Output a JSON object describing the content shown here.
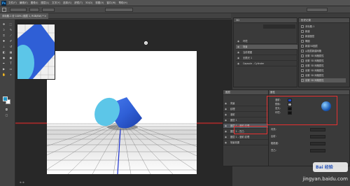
{
  "app": {
    "logo": "Ps"
  },
  "menu": [
    "文件(F)",
    "编辑(E)",
    "图像(I)",
    "图层(L)",
    "文字(Y)",
    "选择(S)",
    "滤镜(T)",
    "3D(D)",
    "视图(V)",
    "窗口(W)",
    "帮助(H)"
  ],
  "document_tab": {
    "label": "未标题-1 @ 100% (图层 1, RGB/8#) * ×"
  },
  "status": {
    "text": "⊕ ⊕"
  },
  "panels": {
    "layers_3d": {
      "title": "3D",
      "items": [
        "环境",
        "场景",
        "当前视图",
        "无限光 1",
        "Capsule - Cylinder"
      ]
    },
    "history": {
      "title": "历史记录",
      "items": [
        "未标题-1",
        "新建",
        "新建图层",
        "椭圆",
        "新建3D图层",
        "从图层新建网格",
        "设置 3D 网格属性",
        "设置 3D 网格属性",
        "设置 3D 网格属性",
        "设置 3D 网格属性",
        "设置 3D 网格属性",
        "设置 3D 网格属性"
      ]
    },
    "properties": {
      "title": "属性",
      "rows": [
        "漫射:",
        "镜像:",
        "发光:",
        "环境:",
        "闪亮:",
        "反射:",
        "粗糙度:",
        "凹凸:"
      ]
    },
    "layers": {
      "title": "图层",
      "rows": [
        "背景",
        "纹理",
        "漫射",
        "图层 1",
        "图层 1 - 漫射 纹理",
        "图层 1 - 凹凸",
        "图层 1 - 漫射 纹理",
        "场景效果"
      ]
    }
  },
  "watermark": {
    "text": "jingyan.baidu.com",
    "logo_text": "Bai 经验"
  },
  "colors": {
    "accent_red": "#e53030",
    "cylinder_side": "#2f5fd6",
    "cylinder_top": "#5cc6e8",
    "ground_grid": "#666666",
    "horizon_line": "#d93030",
    "axis_line": "#1a2fd0"
  }
}
